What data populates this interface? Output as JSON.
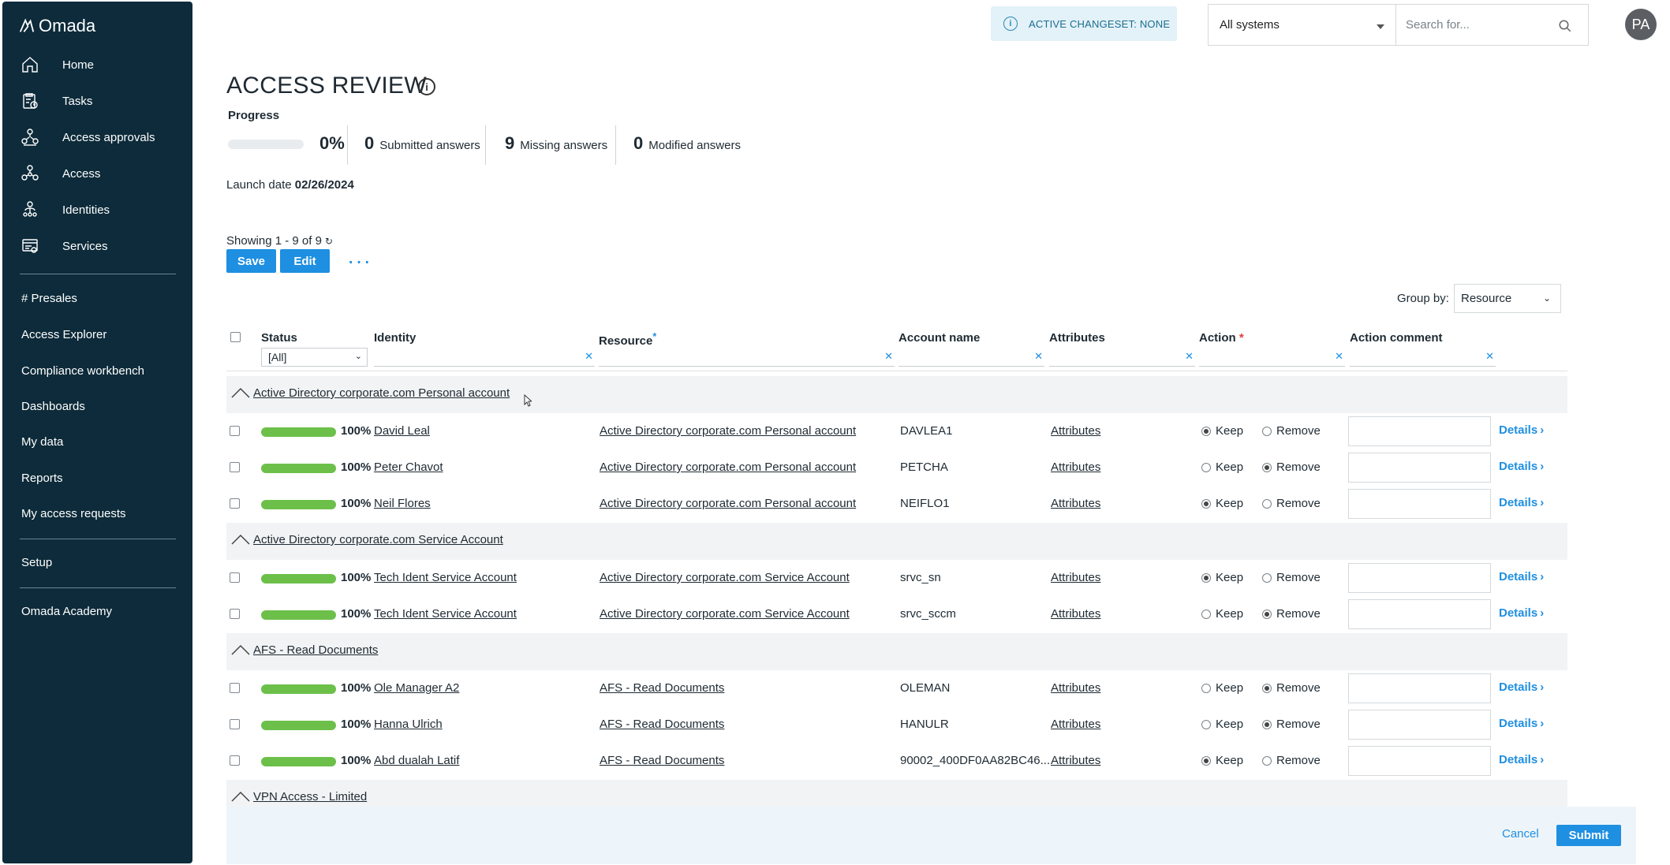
{
  "app": {
    "logo_text": "Omada"
  },
  "sidebar": {
    "items": [
      {
        "label": "Home",
        "icon": "home-icon"
      },
      {
        "label": "Tasks",
        "icon": "tasks-icon"
      },
      {
        "label": "Access approvals",
        "icon": "approvals-icon"
      },
      {
        "label": "Access",
        "icon": "access-icon"
      },
      {
        "label": "Identities",
        "icon": "identities-icon"
      },
      {
        "label": "Services",
        "icon": "services-icon"
      }
    ],
    "links": [
      "# Presales",
      "Access Explorer",
      "Compliance workbench",
      "Dashboards",
      "My data",
      "Reports",
      "My access requests",
      "Setup",
      "Omada Academy"
    ]
  },
  "topbar": {
    "changeset": "ACTIVE CHANGESET: NONE",
    "systems_selected": "All systems",
    "search_placeholder": "Search for...",
    "avatar_initials": "PA"
  },
  "page": {
    "title": "ACCESS REVIEW",
    "progress_label": "Progress",
    "progress_value": 0,
    "progress_pct": "0%",
    "submitted_count": "0",
    "submitted_label": "Submitted answers",
    "missing_count": "9",
    "missing_label": "Missing answers",
    "modified_count": "0",
    "modified_label": "Modified answers",
    "launch_label": "Launch date",
    "launch_date": "02/26/2024",
    "showing": "Showing 1 - 9 of 9",
    "save_label": "Save",
    "edit_label": "Edit",
    "group_by_label": "Group by:",
    "group_by_value": "Resource"
  },
  "table": {
    "headers": {
      "status": "Status",
      "identity": "Identity",
      "resource": "Resource",
      "account": "Account name",
      "attributes": "Attributes",
      "action": "Action",
      "comment": "Action comment"
    },
    "status_filter": "[All]",
    "groups": [
      {
        "label": "Active Directory corporate.com Personal account",
        "rows": [
          {
            "pct": "100%",
            "identity": "David Leal",
            "resource": "Active Directory corporate.com Personal account",
            "account": "DAVLEA1",
            "attributes": "Attributes",
            "keep": true
          },
          {
            "pct": "100%",
            "identity": "Peter Chavot",
            "resource": "Active Directory corporate.com Personal account",
            "account": "PETCHA",
            "attributes": "Attributes",
            "keep": false
          },
          {
            "pct": "100%",
            "identity": "Neil Flores",
            "resource": "Active Directory corporate.com Personal account",
            "account": "NEIFLO1",
            "attributes": "Attributes",
            "keep": true
          }
        ]
      },
      {
        "label": "Active Directory corporate.com Service Account",
        "rows": [
          {
            "pct": "100%",
            "identity": "Tech Ident Service Account",
            "resource": "Active Directory corporate.com Service Account",
            "account": "srvc_sn",
            "attributes": "Attributes",
            "keep": true
          },
          {
            "pct": "100%",
            "identity": "Tech Ident Service Account",
            "resource": "Active Directory corporate.com Service Account",
            "account": "srvc_sccm",
            "attributes": "Attributes",
            "keep": false
          }
        ]
      },
      {
        "label": "AFS - Read Documents",
        "rows": [
          {
            "pct": "100%",
            "identity": "Ole Manager A2",
            "resource": "AFS - Read Documents",
            "account": "OLEMAN",
            "attributes": "Attributes",
            "keep": false
          },
          {
            "pct": "100%",
            "identity": "Hanna Ulrich",
            "resource": "AFS - Read Documents",
            "account": "HANULR",
            "attributes": "Attributes",
            "keep": false
          },
          {
            "pct": "100%",
            "identity": "Abd dualah Latif",
            "resource": "AFS - Read Documents",
            "account": "90002_400DF0AA82BC46...",
            "attributes": "Attributes",
            "keep": true
          }
        ]
      },
      {
        "label": "VPN Access - Limited",
        "rows": []
      }
    ],
    "keep_label": "Keep",
    "remove_label": "Remove",
    "details_label": "Details"
  },
  "footer": {
    "cancel_label": "Cancel",
    "submit_label": "Submit"
  },
  "colors": {
    "sidebar_bg": "#0d2b3a",
    "accent": "#1f8fe1",
    "progress_green": "#6cc04a"
  }
}
